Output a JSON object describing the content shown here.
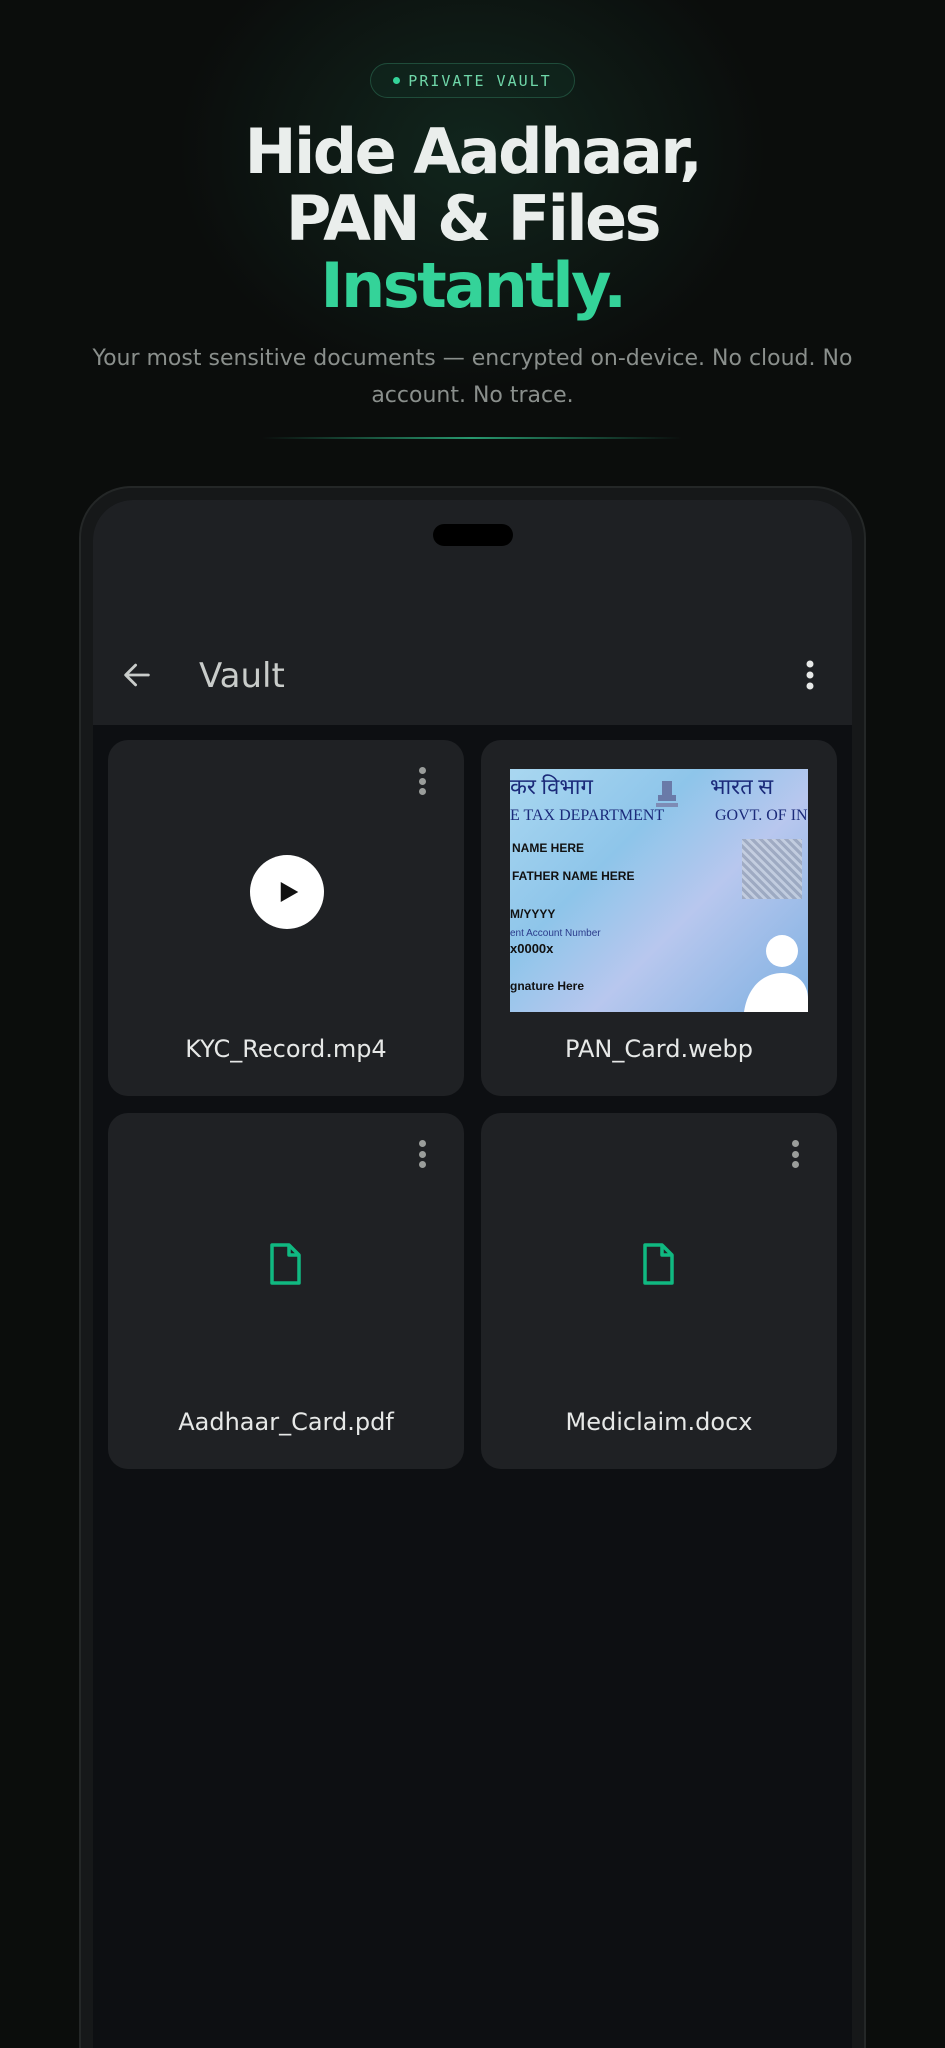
{
  "badge": {
    "label": "PRIVATE VAULT"
  },
  "headline": {
    "line1": "Hide Aadhaar,",
    "line2": "PAN & Files",
    "line3": "Instantly."
  },
  "subtitle": "Your most sensitive documents — encrypted on-device. No cloud. No account. No trace.",
  "appbar": {
    "title": "Vault"
  },
  "files": [
    {
      "name": "KYC_Record.mp4",
      "type": "video"
    },
    {
      "name": "PAN_Card.webp",
      "type": "image"
    },
    {
      "name": "Aadhaar_Card.pdf",
      "type": "document"
    },
    {
      "name": "Mediclaim.docx",
      "type": "document"
    }
  ],
  "pan_thumbnail": {
    "dept_hindi": "कर विभाग",
    "govt_hindi": "भारत स",
    "dept_en": "E TAX DEPARTMENT",
    "govt_en": "GOVT. OF IN",
    "name": "NAME HERE",
    "father": "FATHER NAME HERE",
    "dob": "M/YYYY",
    "acct": "ent Account Number",
    "number": "x0000x",
    "sign": "gnature Here"
  },
  "colors": {
    "accent": "#34d399",
    "background": "#0b0d0c",
    "card": "#1f2124"
  }
}
